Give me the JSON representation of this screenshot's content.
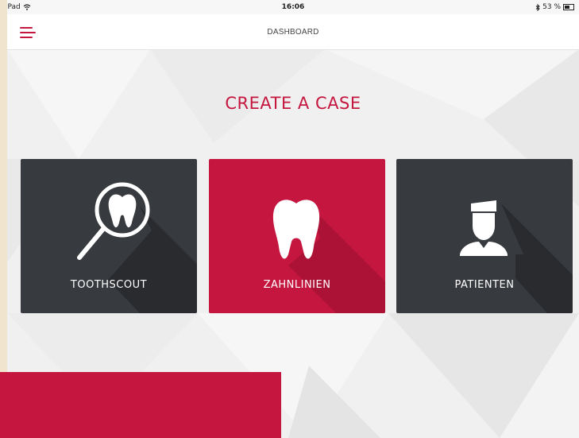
{
  "status_bar": {
    "device": "iPad",
    "time": "16:06",
    "battery": "53 %"
  },
  "header": {
    "title": "DASHBOARD",
    "menu_icon": "hamburger-menu-icon"
  },
  "main": {
    "heading": "CREATE A CASE",
    "tiles": [
      {
        "label": "TOOTHSCOUT",
        "icon": "magnifier-tooth-icon"
      },
      {
        "label": "ZAHNLINIEN",
        "icon": "tooth-icon"
      },
      {
        "label": "PATIENTEN",
        "icon": "patient-icon"
      }
    ]
  },
  "colors": {
    "accent": "#c5163f",
    "tile_dark": "#373a3e",
    "background": "#f0f0f0"
  }
}
